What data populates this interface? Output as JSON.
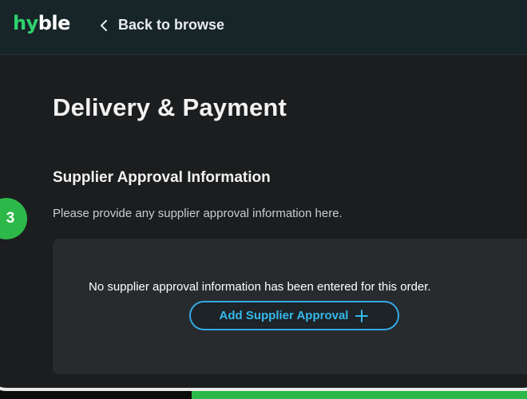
{
  "header": {
    "logo_part1": "hy",
    "logo_part2": "ble",
    "back_label": "Back to browse"
  },
  "page": {
    "title": "Delivery & Payment"
  },
  "supplier_approval": {
    "title": "Supplier Approval Information",
    "description": "Please provide any supplier approval information here.",
    "empty_message": "No supplier approval information has been entered for this order.",
    "add_button_label": "Add Supplier Approval"
  },
  "step_badge": "3",
  "icons": {
    "back": "chevron-left-icon",
    "add": "plus-icon"
  },
  "colors": {
    "brand_green": "#2dd36f",
    "accent_green": "#2db84a",
    "button_blue": "#35b9ec",
    "header_bg": "#182528",
    "page_bg": "#1b1d1f",
    "panel_bg": "#272b2e"
  }
}
